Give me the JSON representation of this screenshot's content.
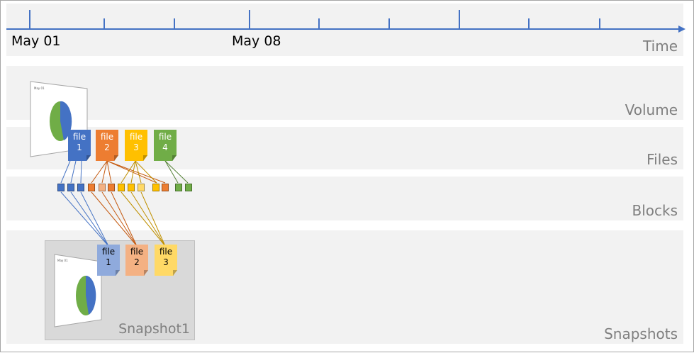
{
  "timeline": {
    "dates": [
      "May 01",
      "May 08"
    ]
  },
  "rows": {
    "time": "Time",
    "volume": "Volume",
    "files": "Files",
    "blocks": "Blocks",
    "snapshots": "Snapshots"
  },
  "files": [
    {
      "word": "file",
      "num": "1",
      "color": "#4472c4",
      "text_color": "#ffffff"
    },
    {
      "word": "file",
      "num": "2",
      "color": "#ed7d31",
      "text_color": "#ffffff"
    },
    {
      "word": "file",
      "num": "3",
      "color": "#ffc000",
      "text_color": "#ffffff"
    },
    {
      "word": "file",
      "num": "4",
      "color": "#70ad47",
      "text_color": "#ffffff"
    }
  ],
  "snapshot": {
    "label": "Snapshot1",
    "files": [
      {
        "word": "file",
        "num": "1",
        "color": "#8faadc",
        "text_color": "#000000"
      },
      {
        "word": "file",
        "num": "2",
        "color": "#f4b183",
        "text_color": "#000000"
      },
      {
        "word": "file",
        "num": "3",
        "color": "#ffd966",
        "text_color": "#000000"
      }
    ]
  },
  "blocks": [
    {
      "owner": "file1",
      "color": "#4472c4"
    },
    {
      "owner": "file1",
      "color": "#4472c4"
    },
    {
      "owner": "file1",
      "color": "#4472c4"
    },
    {
      "owner": "file2",
      "color": "#ed7d31"
    },
    {
      "owner": "file2",
      "color": "#f4b183"
    },
    {
      "owner": "file2",
      "color": "#ed7d31"
    },
    {
      "owner": "file3",
      "color": "#ffc000"
    },
    {
      "owner": "file3",
      "color": "#ffc000"
    },
    {
      "owner": "file3",
      "color": "#ffd966"
    },
    {
      "owner": "file2",
      "color": "#ffc000"
    },
    {
      "owner": "file2",
      "color": "#ed7d31"
    },
    {
      "owner": "file4",
      "color": "#70ad47"
    },
    {
      "owner": "file4",
      "color": "#70ad47"
    }
  ],
  "thumbnail": {
    "title": "May 01",
    "slice_colors": [
      "#4472c4",
      "#70ad47"
    ]
  },
  "colors": {
    "axis": "#4472c4",
    "band": "#f2f2f2",
    "label": "#7f7f7f"
  }
}
